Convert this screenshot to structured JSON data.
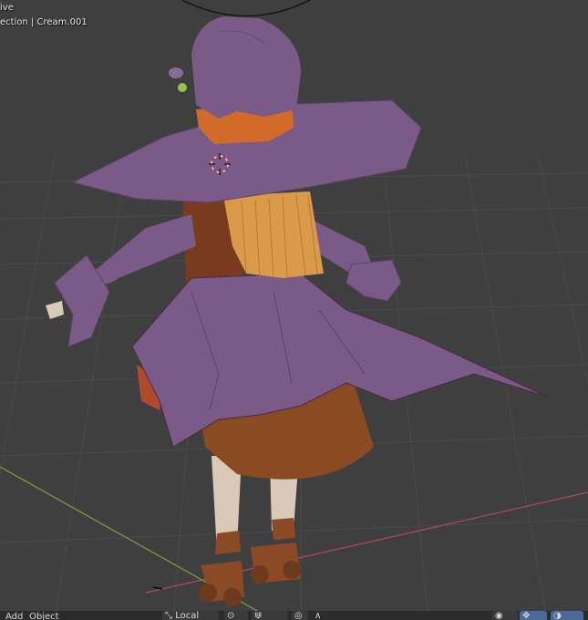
{
  "viewport": {
    "mode_text": "ive",
    "collection_text": "ection | Cream.001"
  },
  "header_menu": {
    "add_label": "Add",
    "object_label": "Object"
  },
  "toolbar": {
    "transform_orientation_label": "Local",
    "transform_orientation_icon": "axis-icon",
    "pivot_icon": "pivot-icon",
    "snap_icon": "magnet-icon",
    "proportional_icon": "proportional-edit-icon",
    "falloff_icon": "falloff-curve-icon",
    "visibility_icon": "eye-icon",
    "gizmo_icon": "gizmo-icon",
    "overlay_icon": "overlay-icon"
  },
  "colors": {
    "viewport_bg": "#3f3f3f",
    "grid_line": "#4a4a4a",
    "x_axis": "#b8485a",
    "y_axis": "#7ea03a",
    "hat_purple": "#7a5a86",
    "hair_orange": "#d99a4a",
    "dress_brown": "#8a4a22"
  }
}
